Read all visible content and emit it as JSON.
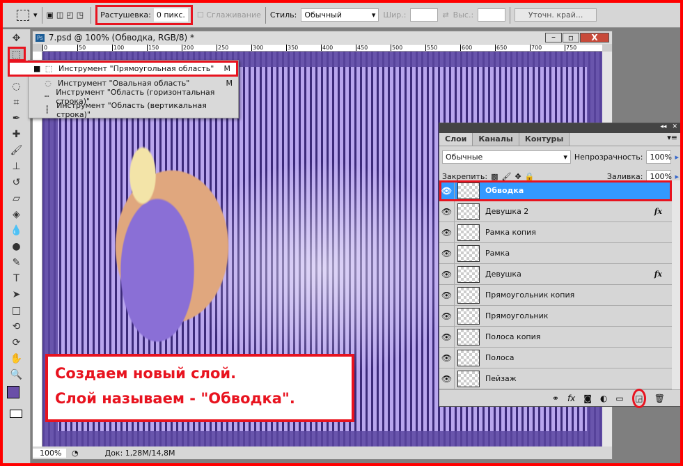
{
  "options_bar": {
    "feather_label": "Растушевка:",
    "feather_value": "0 пикс.",
    "antialias_label": "Сглаживание",
    "style_label": "Стиль:",
    "style_value": "Обычный",
    "width_label": "Шир.:",
    "height_label": "Выс.:",
    "refine_edge": "Уточн. край..."
  },
  "document": {
    "title": "7.psd @ 100% (Обводка, RGB/8) *",
    "ruler_ticks": [
      "0",
      "50",
      "100",
      "150",
      "200",
      "250",
      "300",
      "350",
      "400",
      "450",
      "500",
      "550",
      "600",
      "650",
      "700",
      "750"
    ],
    "zoom": "100%",
    "doc_info": "Док: 1,28M/14,8M"
  },
  "tool_menu": {
    "items": [
      {
        "label": "Инструмент \"Прямоугольная область\"",
        "key": "M",
        "selected": true
      },
      {
        "label": "Инструмент \"Овальная область\"",
        "key": "M"
      },
      {
        "label": "Инструмент \"Область (горизонтальная строка)\"",
        "key": ""
      },
      {
        "label": "Инструмент \"Область (вертикальная строка)\"",
        "key": ""
      }
    ]
  },
  "annotation": {
    "line1": "Создаем новый слой.",
    "line2": "Слой называем - \"Обводка\"."
  },
  "layers_panel": {
    "tabs": [
      "Слои",
      "Каналы",
      "Контуры"
    ],
    "blend_mode": "Обычные",
    "opacity_label": "Непрозрачность:",
    "opacity": "100%",
    "lock_label": "Закрепить:",
    "fill_label": "Заливка:",
    "fill": "100%",
    "layers": [
      {
        "name": "Обводка",
        "selected": true
      },
      {
        "name": "Девушка 2",
        "fx": "fx"
      },
      {
        "name": "Рамка копия"
      },
      {
        "name": "Рамка"
      },
      {
        "name": "Девушка",
        "fx": "fx"
      },
      {
        "name": "Прямоугольник копия"
      },
      {
        "name": "Прямоугольник"
      },
      {
        "name": "Полоса копия"
      },
      {
        "name": "Полоса"
      },
      {
        "name": "Пейзаж"
      }
    ]
  },
  "colors": {
    "highlight": "#e8131f",
    "selection": "#3399ff",
    "foreground": "#6a4fa8"
  }
}
